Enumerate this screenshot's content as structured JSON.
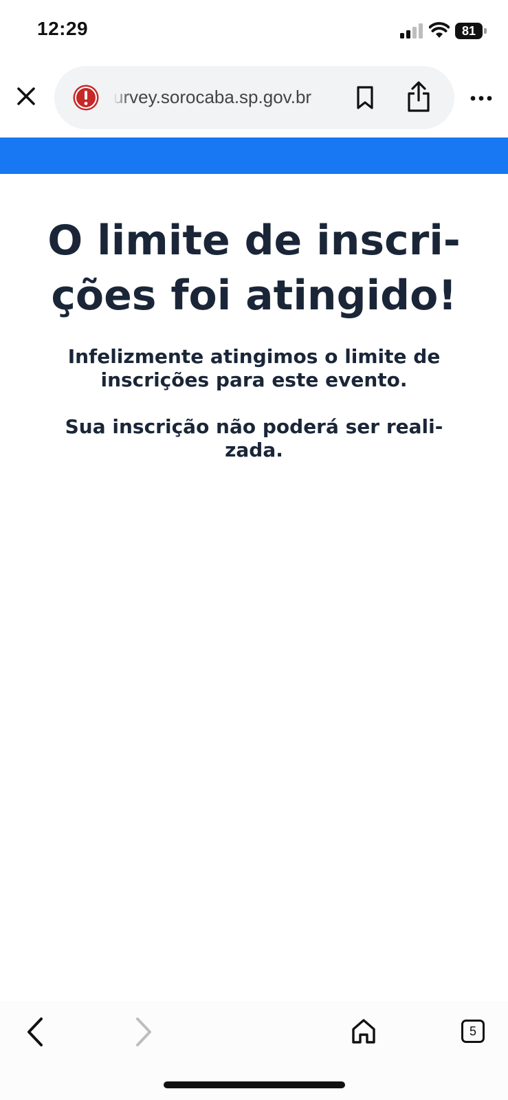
{
  "status_bar": {
    "time": "12:29",
    "battery_level": "81",
    "signal_bars_active": 2,
    "signal_bars_total": 4
  },
  "browser": {
    "url": "urvey.sorocaba.sp.gov.br",
    "security_status": "warning",
    "tab_count": "5",
    "accent_color": "#1877f2",
    "warning_color": "#c62828"
  },
  "page": {
    "headline_line1": "O limite de inscri-",
    "headline_line2": "ções foi atingido!",
    "message_line1": "Infelizmente atingimos o limite de",
    "message_line2": "inscrições para este evento.",
    "notice_line1": "Sua inscrição não poderá ser reali-",
    "notice_line2": "zada."
  },
  "icons": {
    "close": "close-icon",
    "security": "alert-icon",
    "bookmark": "bookmark-icon",
    "share": "share-icon",
    "more": "more-icon",
    "back": "chevron-left-icon",
    "forward": "chevron-right-icon",
    "home": "home-icon"
  }
}
